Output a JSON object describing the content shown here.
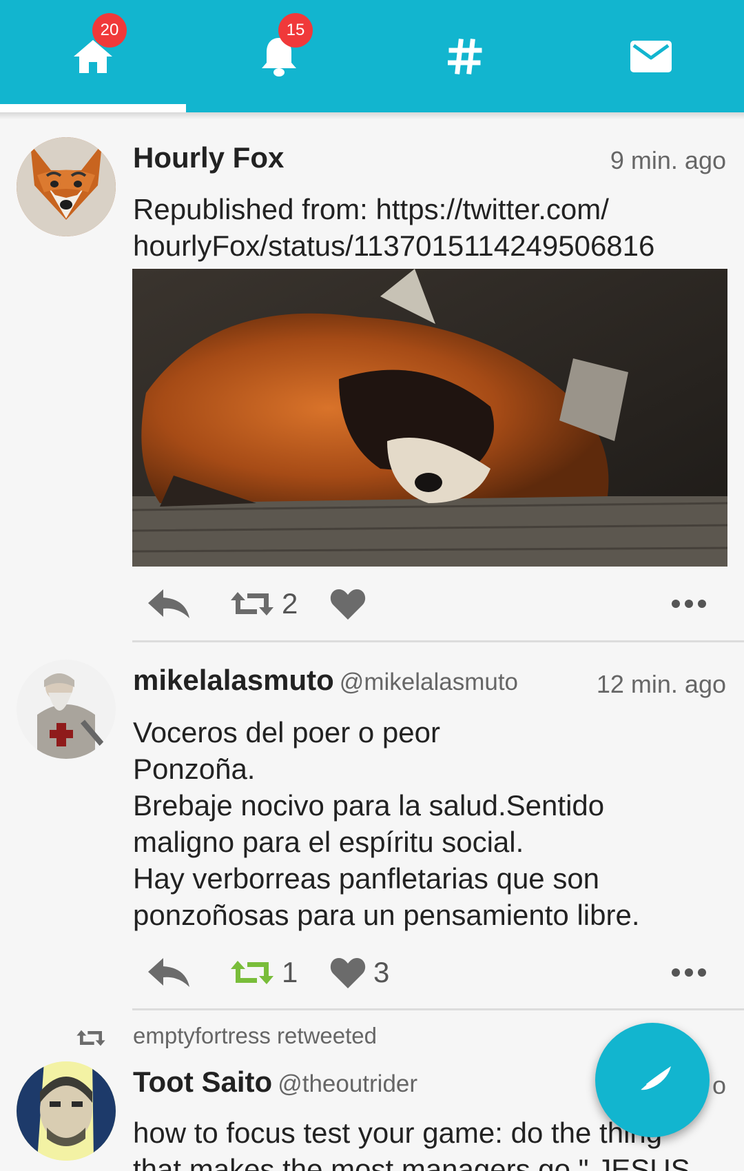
{
  "tabs": [
    {
      "name": "home",
      "badge": "20",
      "active": true
    },
    {
      "name": "notifications",
      "badge": "15",
      "active": false
    },
    {
      "name": "hashtags",
      "badge": "",
      "active": false
    },
    {
      "name": "messages",
      "badge": "",
      "active": false
    }
  ],
  "colors": {
    "accent": "#12b5cf",
    "badge": "#f0393a",
    "reblogged": "#79bd3a"
  },
  "posts": [
    {
      "author": "Hourly Fox",
      "handle": "",
      "time": "9 min. ago",
      "content": "Republished from: https://twitter.com/\nhourlyFox/status/1137015114249506816",
      "has_media": true,
      "reblogs": "2",
      "favourites": ""
    },
    {
      "author": "mikelalasmuto",
      "handle": "@mikelalasmuto",
      "time": "12 min. ago",
      "content": "Voceros del poer o peor\nPonzoña.\nBrebaje nocivo para la salud.Sentido\nmaligno para el espíritu social.\nHay verborreas panfletarias que son\nponzoñosas para un pensamiento libre.",
      "has_media": false,
      "reblogs": "1",
      "favourites": "3"
    },
    {
      "reblogged_by": "emptyfortress retweeted",
      "author": "Toot Saito",
      "handle": "@theoutrider",
      "time": "1 ... o",
      "content": "how to focus test your game: do the thing\nthat makes the most managers go \" JESUS"
    }
  ],
  "compose": {
    "icon": "quill-icon"
  }
}
